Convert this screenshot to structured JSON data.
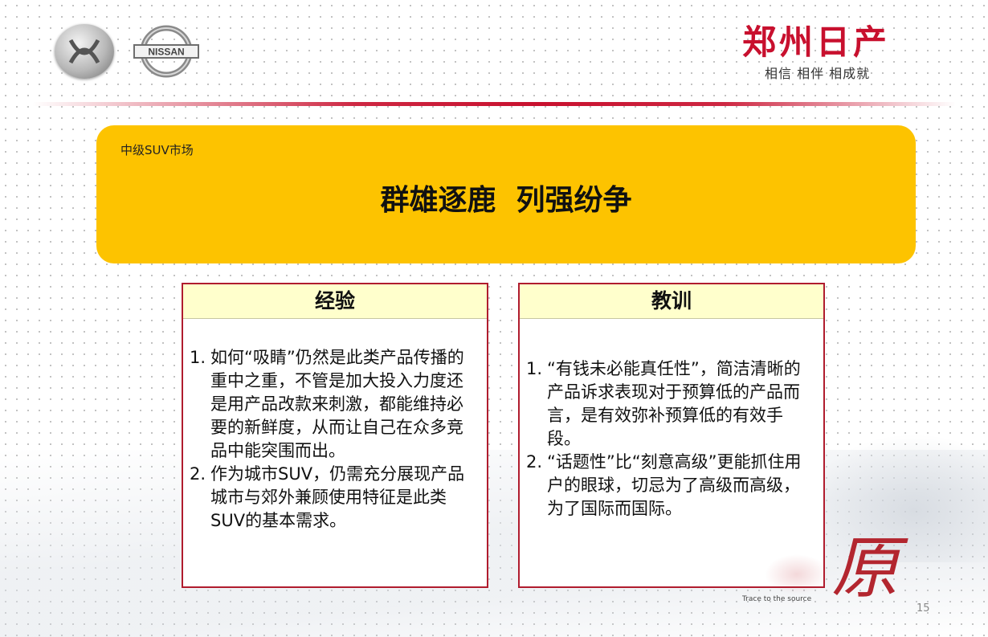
{
  "brand": {
    "title": "郑州日产",
    "slogan": "相信 相伴 相成就",
    "nissan_text": "NISSAN"
  },
  "banner": {
    "subtitle": "中级SUV市场",
    "title": "群雄逐鹿  列强纷争"
  },
  "panels": [
    {
      "heading": "经验",
      "items": [
        {
          "num": "1.",
          "text": "如何“吸睛”仍然是此类产品传播的重中之重，不管是加大投入力度还是用产品改款来刺激，都能维持必要的新鲜度，从而让自己在众多竞品中能突围而出。"
        },
        {
          "num": "2.",
          "text": "作为城市SUV，仍需充分展现产品城市与郊外兼顾使用特征是此类SUV的基本需求。"
        }
      ]
    },
    {
      "heading": "教训",
      "items": [
        {
          "num": "1.",
          "text": "“有钱未必能真任性”，简洁清晰的产品诉求表现对于预算低的产品而言，是有效弥补预算低的有效手段。"
        },
        {
          "num": "2.",
          "text": "“话题性”比“刻意高级”更能抓住用户的眼球，切忌为了高级而高级，为了国际而国际。"
        }
      ]
    }
  ],
  "footer": {
    "calligraphy": "原",
    "tagline": "Trace to the source",
    "page_number": "15"
  },
  "colors": {
    "accent_red": "#c8102e",
    "banner_yellow": "#fdc300",
    "panel_head": "#ffffcc",
    "panel_border": "#b01c2e"
  }
}
